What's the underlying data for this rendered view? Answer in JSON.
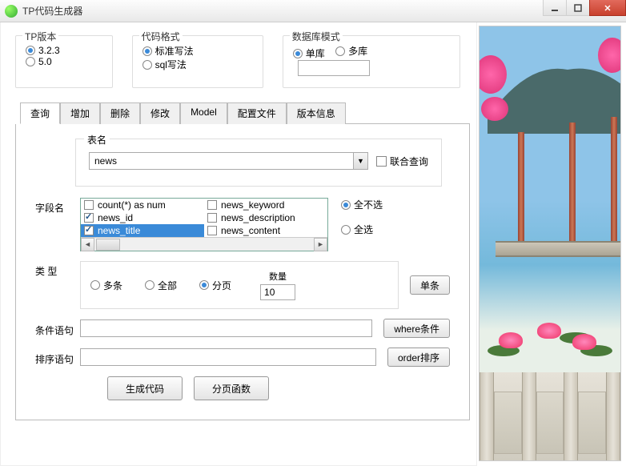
{
  "window": {
    "title": "TP代码生成器"
  },
  "groups": {
    "version": {
      "label": "TP版本",
      "options": [
        "3.2.3",
        "5.0"
      ],
      "selected": 0
    },
    "format": {
      "label": "代码格式",
      "options": [
        "标准写法",
        "sql写法"
      ],
      "selected": 0
    },
    "dbmode": {
      "label": "数据库模式",
      "options": [
        "单库",
        "多库"
      ],
      "selected": 0,
      "input_value": ""
    }
  },
  "tabs": {
    "items": [
      "查询",
      "增加",
      "删除",
      "修改",
      "Model",
      "配置文件",
      "版本信息"
    ],
    "active": 0
  },
  "table": {
    "label": "表名",
    "value": "news",
    "union_label": "联合查询",
    "union_checked": false
  },
  "fields": {
    "label": "字段名",
    "left": [
      {
        "name": "count(*) as num",
        "checked": false,
        "selected": false
      },
      {
        "name": "news_id",
        "checked": true,
        "selected": false
      },
      {
        "name": "news_title",
        "checked": true,
        "selected": true
      }
    ],
    "right": [
      {
        "name": "news_keyword",
        "checked": false
      },
      {
        "name": "news_description",
        "checked": false
      },
      {
        "name": "news_content",
        "checked": false
      }
    ],
    "select_none": "全不选",
    "select_all": "全选",
    "side_selected": 0
  },
  "type": {
    "label": "类  型",
    "options": [
      "多条",
      "全部",
      "分页"
    ],
    "selected": 2,
    "qty_label": "数量",
    "qty_value": "10",
    "single_btn": "单条"
  },
  "condition": {
    "label": "条件语句",
    "value": "",
    "btn": "where条件"
  },
  "order": {
    "label": "排序语句",
    "value": "",
    "btn": "order排序"
  },
  "buttons": {
    "generate": "生成代码",
    "paginate": "分页函数"
  }
}
